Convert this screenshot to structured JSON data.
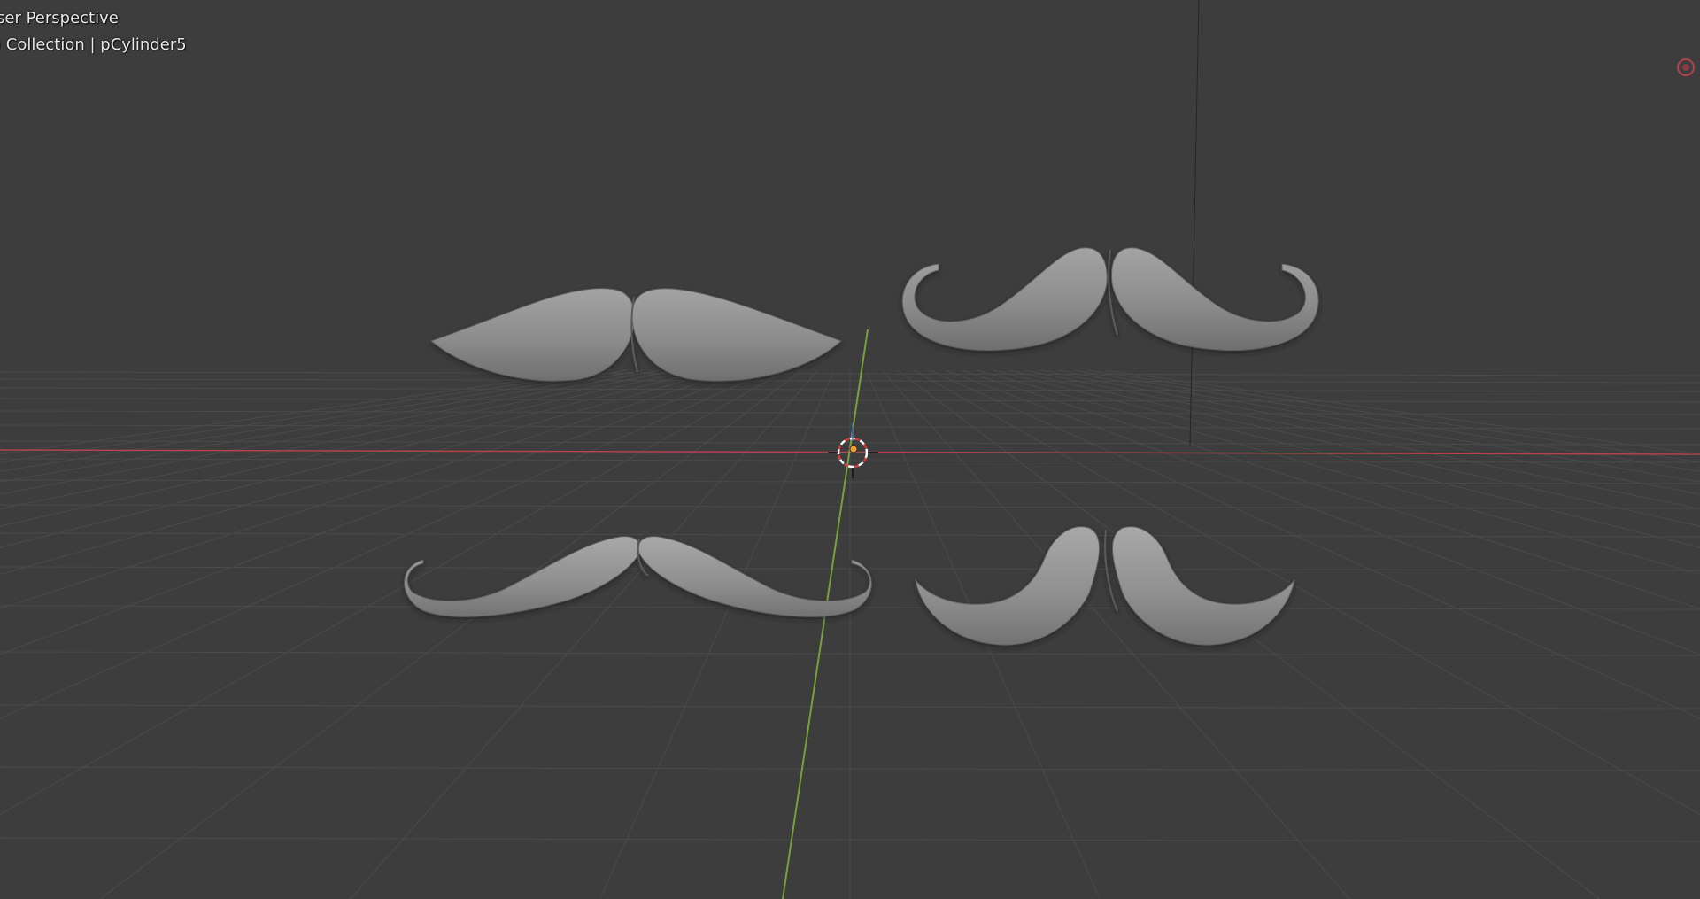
{
  "viewport": {
    "view_name": "ser Perspective",
    "collection_info": ") Collection | pCylinder5",
    "background_color": "#3d3d3d",
    "x_axis_color": "#b3434d",
    "y_axis_color": "#7aa03a",
    "grid_color": "#4a4a4a",
    "mesh_color": "#8c8c8c",
    "icons": {
      "cursor": "3d-cursor-icon",
      "origin": "object-origin-icon",
      "record": "record-indicator-icon"
    },
    "objects": [
      {
        "name": "mustache-top-left",
        "shape": "chevron"
      },
      {
        "name": "mustache-top-right",
        "shape": "curled-handlebar"
      },
      {
        "name": "mustache-bottom-left",
        "shape": "thin-handlebar"
      },
      {
        "name": "mustache-bottom-right",
        "shape": "walrus-curve"
      }
    ]
  }
}
